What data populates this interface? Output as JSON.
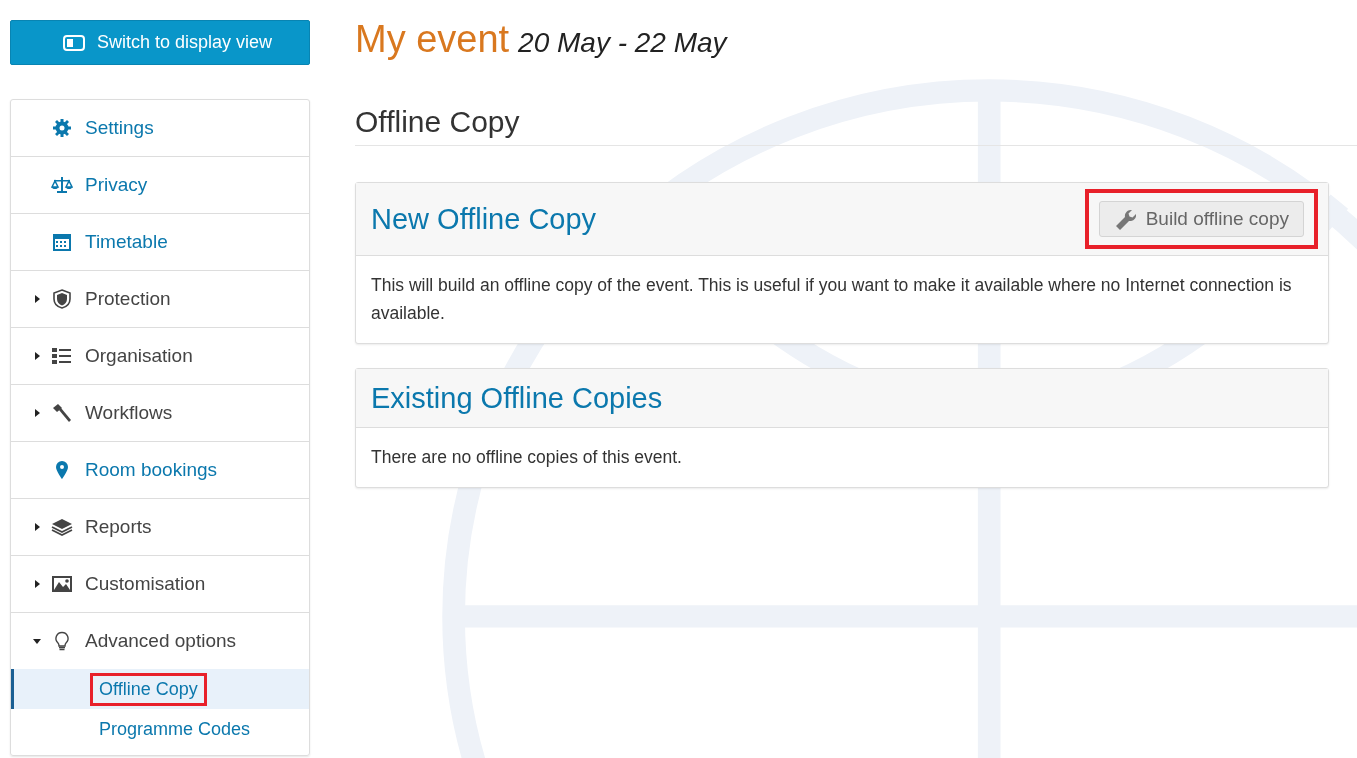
{
  "display_button": {
    "label": "Switch to display view"
  },
  "sidebar": {
    "items": [
      {
        "label": "Settings",
        "kind": "link"
      },
      {
        "label": "Privacy",
        "kind": "link"
      },
      {
        "label": "Timetable",
        "kind": "link"
      },
      {
        "label": "Protection",
        "kind": "menu",
        "expanded": false
      },
      {
        "label": "Organisation",
        "kind": "menu",
        "expanded": false
      },
      {
        "label": "Workflows",
        "kind": "menu",
        "expanded": false
      },
      {
        "label": "Room bookings",
        "kind": "link"
      },
      {
        "label": "Reports",
        "kind": "menu",
        "expanded": false
      },
      {
        "label": "Customisation",
        "kind": "menu",
        "expanded": false
      },
      {
        "label": "Advanced options",
        "kind": "menu",
        "expanded": true,
        "children": [
          {
            "label": "Offline Copy",
            "selected": true,
            "highlighted": true
          },
          {
            "label": "Programme Codes",
            "selected": false,
            "highlighted": false
          }
        ]
      }
    ]
  },
  "event": {
    "title": "My event",
    "dates": "20 May - 22 May"
  },
  "page_title": "Offline Copy",
  "panels": [
    {
      "title": "New Offline Copy",
      "button": {
        "label": "Build offline copy",
        "highlighted": true
      },
      "text": "This will build an offline copy of the event. This is useful if you want to make it available where no Internet connection is available."
    },
    {
      "title": "Existing Offline Copies",
      "text": "There are no offline copies of this event."
    }
  ]
}
